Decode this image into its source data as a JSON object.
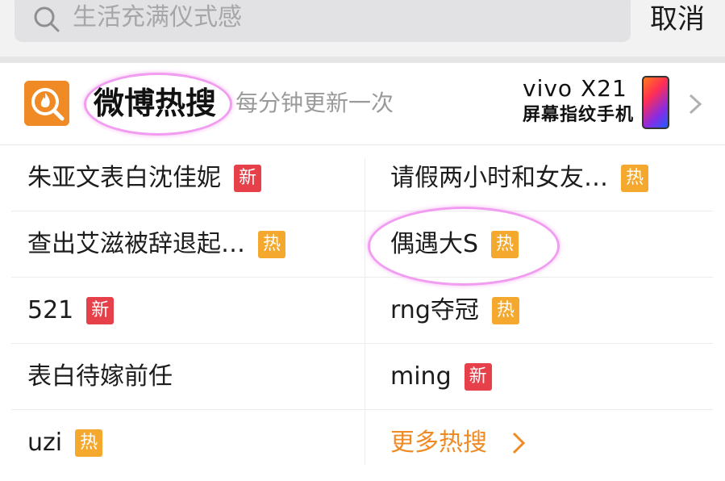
{
  "search": {
    "placeholder": "生活充满仪式感",
    "cancel_label": "取消"
  },
  "hot_header": {
    "title": "微博热搜",
    "subtitle": "每分钟更新一次",
    "ad_brand": "vivo X21",
    "ad_text": "屏幕指纹手机"
  },
  "hot_items": [
    {
      "text": "朱亚文表白沈佳妮",
      "badge": "新",
      "badge_type": "new"
    },
    {
      "text": "请假两小时和女友…",
      "badge": "热",
      "badge_type": "hot"
    },
    {
      "text": "查出艾滋被辞退起…",
      "badge": "热",
      "badge_type": "hot"
    },
    {
      "text": "偶遇大S",
      "badge": "热",
      "badge_type": "hot"
    },
    {
      "text": "521",
      "badge": "新",
      "badge_type": "new"
    },
    {
      "text": "rng夺冠",
      "badge": "热",
      "badge_type": "hot"
    },
    {
      "text": "表白待嫁前任",
      "badge": "",
      "badge_type": ""
    },
    {
      "text": "ming",
      "badge": "新",
      "badge_type": "new"
    },
    {
      "text": "uzi",
      "badge": "热",
      "badge_type": "hot"
    }
  ],
  "more_label": "更多热搜",
  "colors": {
    "accent": "#f08a24",
    "badge_new": "#e6414a",
    "badge_hot": "#f4a82e",
    "annotation": "#f19cf0"
  },
  "icons": {
    "search": "search-icon",
    "logo": "flame-search-logo-icon",
    "chevron": "chevron-right-icon"
  }
}
